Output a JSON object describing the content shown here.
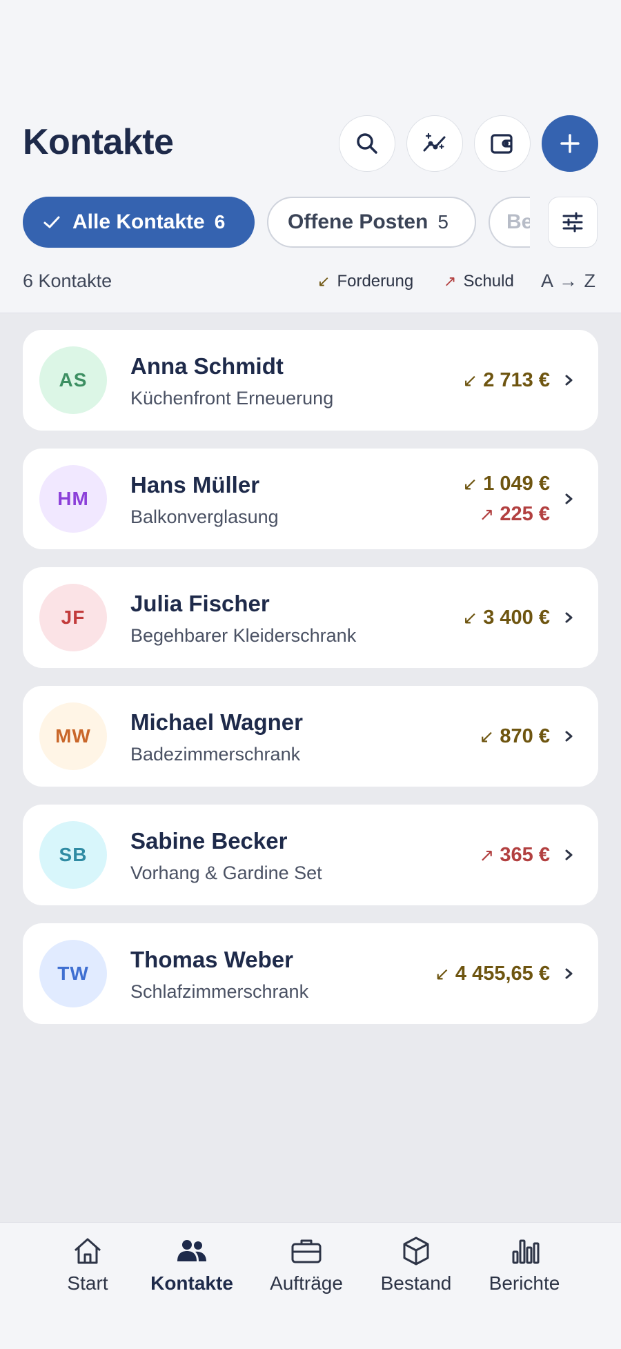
{
  "header": {
    "title": "Kontakte"
  },
  "header_actions": [
    {
      "name": "search-button",
      "icon": "search-icon"
    },
    {
      "name": "insights-button",
      "icon": "sparkle-trend-icon"
    },
    {
      "name": "wallet-button",
      "icon": "wallet-icon"
    },
    {
      "name": "add-contact-button",
      "icon": "plus-icon"
    }
  ],
  "filters": {
    "active": {
      "label": "Alle Kontakte",
      "count": "6"
    },
    "second": {
      "label": "Offene Posten",
      "count": "5"
    },
    "third_partial": "Be"
  },
  "summary": {
    "count_label": "6 Kontakte",
    "legend_forderung": "Forderung",
    "legend_schuld": "Schuld",
    "sort_label": "A → Z",
    "arrow_forderung": "↙",
    "arrow_schuld": "↗"
  },
  "contacts": [
    {
      "initials": "AS",
      "name": "Anna Schmidt",
      "project": "Küchenfront Erneuerung",
      "forderung": "2 713 €",
      "schuld": "",
      "avatar_bg": "#dcf6e6",
      "avatar_fg": "#3d8f62"
    },
    {
      "initials": "HM",
      "name": "Hans Müller",
      "project": "Balkonverglasung",
      "forderung": "1 049 €",
      "schuld": "225 €",
      "avatar_bg": "#f1e8ff",
      "avatar_fg": "#8b3fd9"
    },
    {
      "initials": "JF",
      "name": "Julia Fischer",
      "project": "Begehbarer Kleiderschrank",
      "forderung": "3 400 €",
      "schuld": "",
      "avatar_bg": "#fbe3e6",
      "avatar_fg": "#c23b3b"
    },
    {
      "initials": "MW",
      "name": "Michael Wagner",
      "project": "Badezimmerschrank",
      "forderung": "870 €",
      "schuld": "",
      "avatar_bg": "#fff5e6",
      "avatar_fg": "#c9672a"
    },
    {
      "initials": "SB",
      "name": "Sabine Becker",
      "project": "Vorhang & Gardine Set",
      "forderung": "",
      "schuld": "365 €",
      "avatar_bg": "#d8f6fb",
      "avatar_fg": "#2f8ba3"
    },
    {
      "initials": "TW",
      "name": "Thomas Weber",
      "project": "Schlafzimmerschrank",
      "forderung": "4 455,65 €",
      "schuld": "",
      "avatar_bg": "#e1ebff",
      "avatar_fg": "#3f6fd1"
    }
  ],
  "bottom_nav": [
    {
      "label": "Start",
      "icon": "home-icon",
      "active": false
    },
    {
      "label": "Kontakte",
      "icon": "people-icon",
      "active": true
    },
    {
      "label": "Aufträge",
      "icon": "briefcase-icon",
      "active": false
    },
    {
      "label": "Bestand",
      "icon": "box-icon",
      "active": false
    },
    {
      "label": "Berichte",
      "icon": "bar-chart-icon",
      "active": false
    }
  ],
  "colors": {
    "primary": "#3563b0",
    "forderung": "#6e5510",
    "schuld": "#b24040"
  }
}
